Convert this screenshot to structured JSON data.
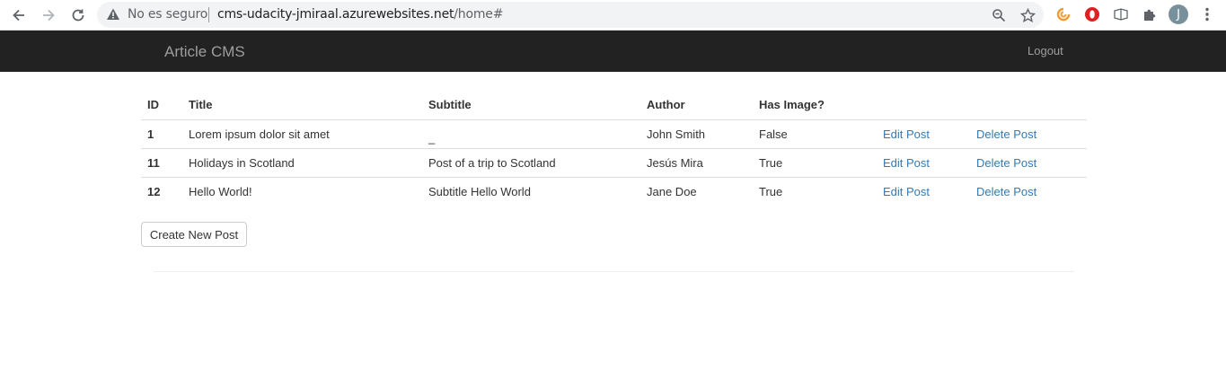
{
  "browser": {
    "security_label": "No es seguro",
    "url_host": "cms-udacity-jmiraal.azurewebsites.net",
    "url_path": "/home#",
    "profile_initial": "J"
  },
  "navbar": {
    "brand": "Article CMS",
    "logout": "Logout"
  },
  "table": {
    "headers": [
      "ID",
      "Title",
      "Subtitle",
      "Author",
      "Has Image?",
      "",
      ""
    ],
    "rows": [
      {
        "id": "1",
        "title": "Lorem ipsum dolor sit amet",
        "subtitle": "_",
        "author": "John Smith",
        "has_image": "False",
        "edit": "Edit Post",
        "delete": "Delete Post"
      },
      {
        "id": "11",
        "title": "Holidays in Scotland",
        "subtitle": "Post of a trip to Scotland",
        "author": "Jesús Mira",
        "has_image": "True",
        "edit": "Edit Post",
        "delete": "Delete Post"
      },
      {
        "id": "12",
        "title": "Hello World!",
        "subtitle": "Subtitle Hello World",
        "author": "Jane Doe",
        "has_image": "True",
        "edit": "Edit Post",
        "delete": "Delete Post"
      }
    ]
  },
  "actions": {
    "create_label": "Create New Post"
  },
  "colors": {
    "navbar_bg": "#222222",
    "navbar_text": "#9d9d9d",
    "link": "#337ab7"
  }
}
